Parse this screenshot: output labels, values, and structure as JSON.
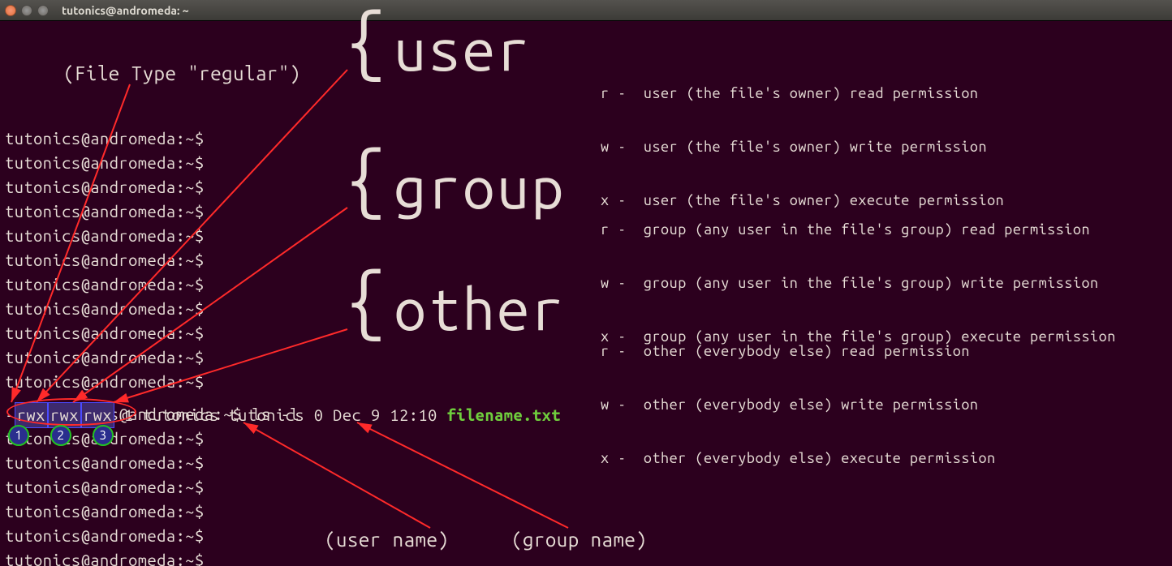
{
  "window": {
    "title": "tutonics@andromeda: ~"
  },
  "prompt": "tutonics@andromeda:~$",
  "command": "ls -l",
  "ls": {
    "type_char": "-",
    "triads": [
      "rwx",
      "rwx",
      "rwx"
    ],
    "links": "1",
    "user": "tutonics",
    "group": "tutonics",
    "size": "0",
    "date": "Dec  9 12:10",
    "filename": "filename.txt"
  },
  "circles": [
    "1",
    "2",
    "3"
  ],
  "annotations": {
    "filetype": "(File Type \"regular\")",
    "username": "(user name)",
    "groupname": "(group name)"
  },
  "sections": {
    "user": {
      "label": "user",
      "lines": [
        "r -  user (the file's owner) read permission",
        "w -  user (the file's owner) write permission",
        "x -  user (the file's owner) execute permission"
      ]
    },
    "group": {
      "label": "group",
      "lines": [
        "r -  group (any user in the file's group) read permission",
        "w -  group (any user in the file's group) write permission",
        "x -  group (any user in the file's group) execute permission"
      ]
    },
    "other": {
      "label": "other",
      "lines": [
        "r -  other (everybody else) read permission",
        "w -  other (everybody else) write permission",
        "x -  other (everybody else) execute permission"
      ]
    }
  },
  "prompt_tops": [
    130,
    160,
    190,
    220,
    250,
    280,
    310,
    340,
    370,
    400,
    430,
    500,
    530,
    560,
    590,
    620,
    650
  ]
}
